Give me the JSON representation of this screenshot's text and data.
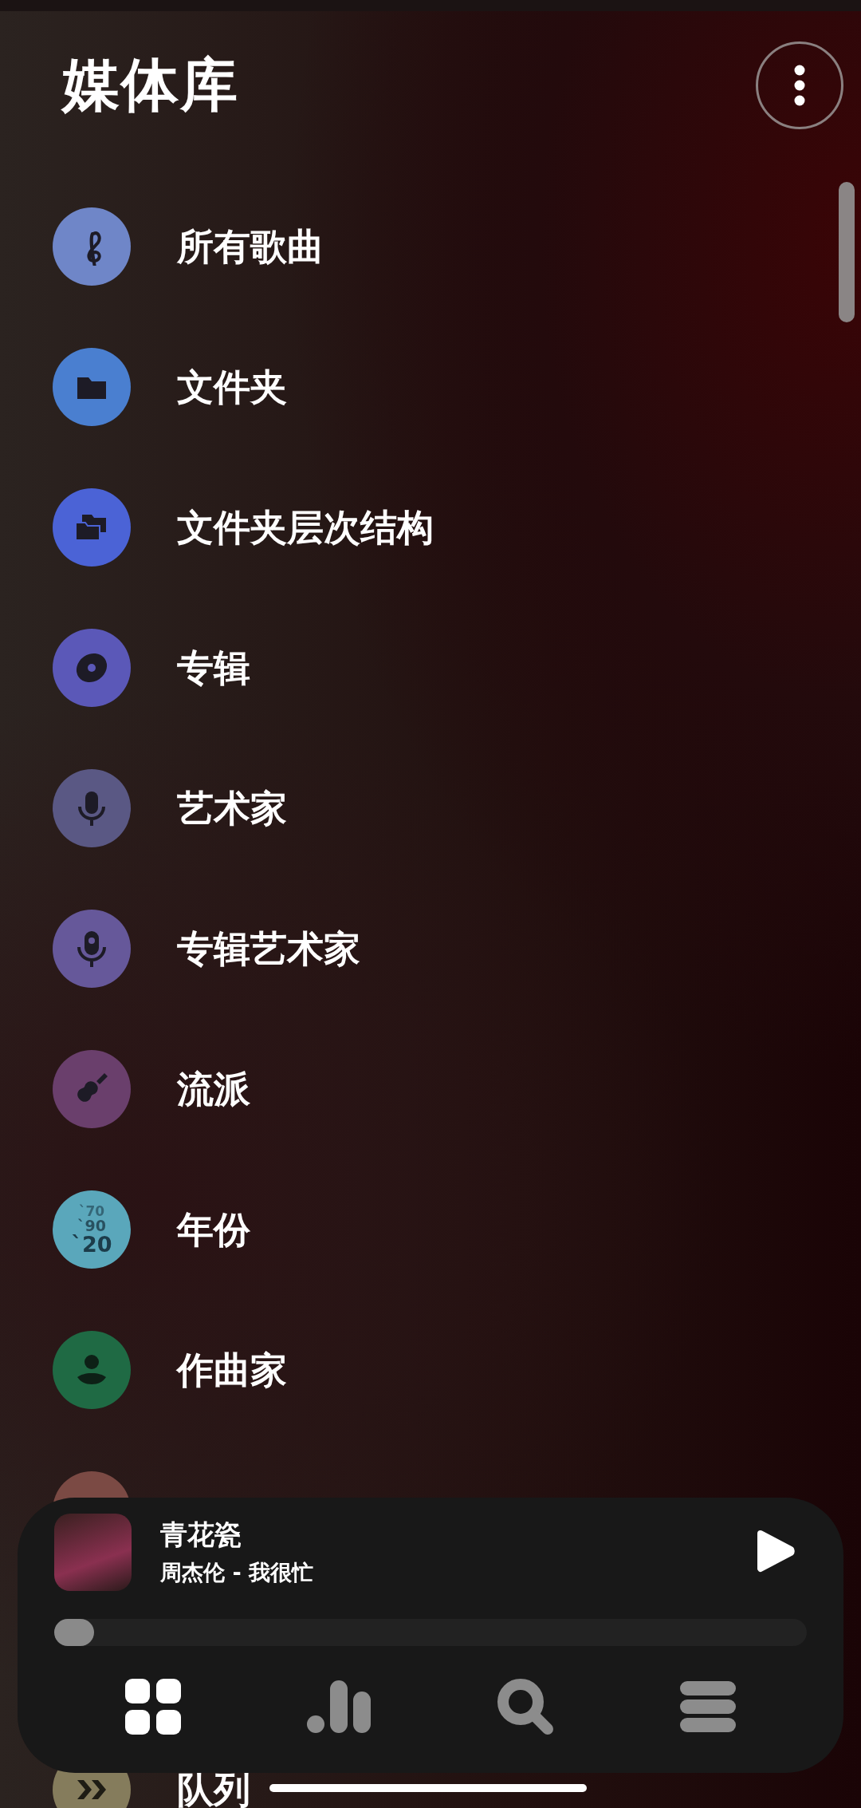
{
  "header": {
    "title": "媒体库"
  },
  "library_items": [
    {
      "kind": "songs",
      "label": "所有歌曲",
      "color": "#6f86c8"
    },
    {
      "kind": "folder",
      "label": "文件夹",
      "color": "#4a7fd0"
    },
    {
      "kind": "folders",
      "label": "文件夹层次结构",
      "color": "#4b63d6"
    },
    {
      "kind": "album",
      "label": "专辑",
      "color": "#5b58b8"
    },
    {
      "kind": "mic",
      "label": "艺术家",
      "color": "#5a5884"
    },
    {
      "kind": "podcast",
      "label": "专辑艺术家",
      "color": "#66589a"
    },
    {
      "kind": "guitar",
      "label": "流派",
      "color": "#6a3f6c"
    },
    {
      "kind": "years",
      "label": "年份",
      "color": "#5aa7bb",
      "icon_text": [
        "`70",
        "`90",
        "`20"
      ]
    },
    {
      "kind": "person",
      "label": "作曲家",
      "color": "#1f6a44"
    },
    {
      "kind": "playlist",
      "color": "#7b4a44"
    },
    {
      "kind": "queue",
      "label": "队列",
      "color": "#857c5c"
    }
  ],
  "now_playing": {
    "title": "青花瓷",
    "subtitle": "周杰伦 - 我很忙",
    "progress": {
      "level": 0.03
    }
  },
  "nav_tabs": [
    {
      "kind": "grid",
      "selected": true
    },
    {
      "kind": "chart",
      "selected": false
    },
    {
      "kind": "search",
      "selected": false
    },
    {
      "kind": "menu",
      "selected": false
    }
  ]
}
